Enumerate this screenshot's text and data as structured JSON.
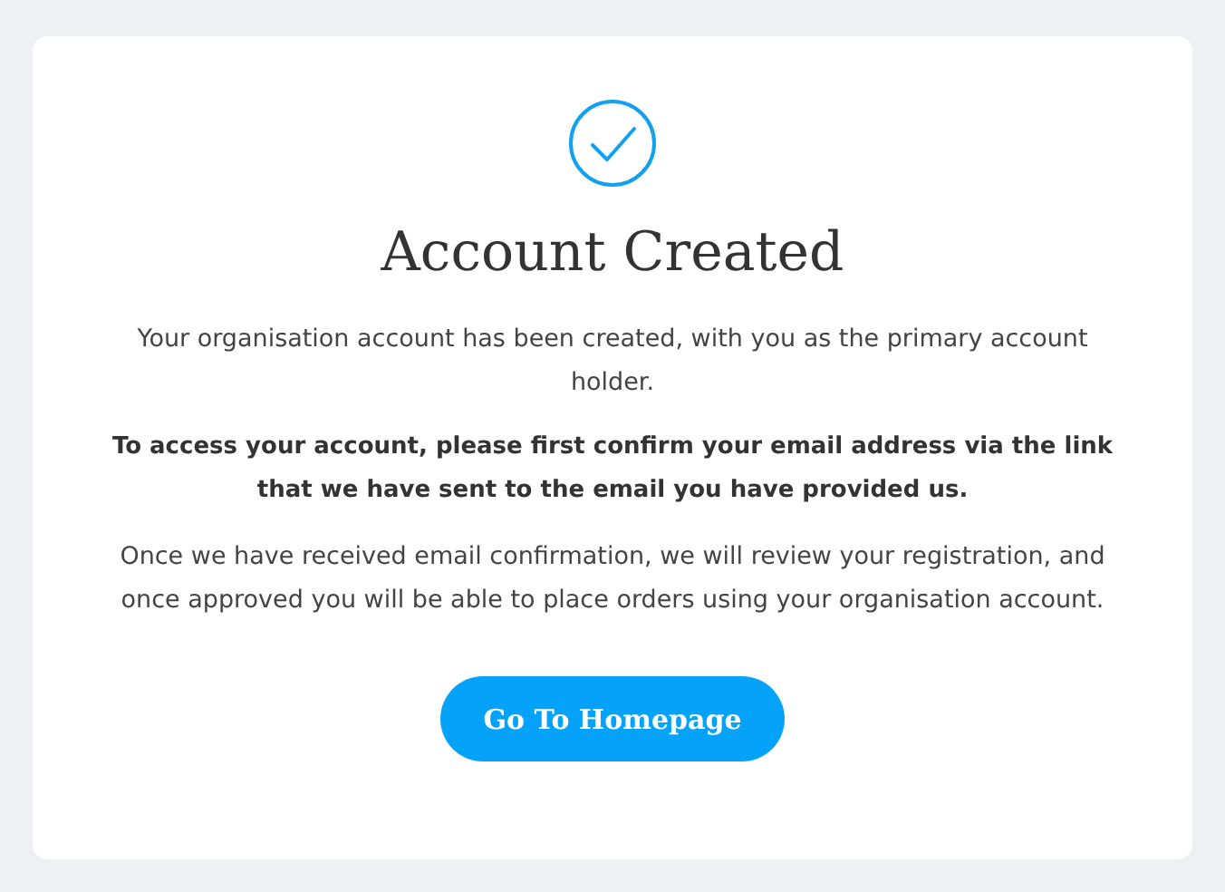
{
  "card": {
    "title": "Account Created",
    "paragraphs": [
      {
        "text": "Your organisation account has been created, with you as the primary account holder.",
        "bold": false
      },
      {
        "text": "To access your account, please first confirm your email address via the link that we have sent to the email you have provided us.",
        "bold": true
      },
      {
        "text": "Once we have received email confirmation, we will review your registration, and once approved you will be able to place orders using your organisation account.",
        "bold": false
      }
    ],
    "button": "Go To Homepage"
  }
}
